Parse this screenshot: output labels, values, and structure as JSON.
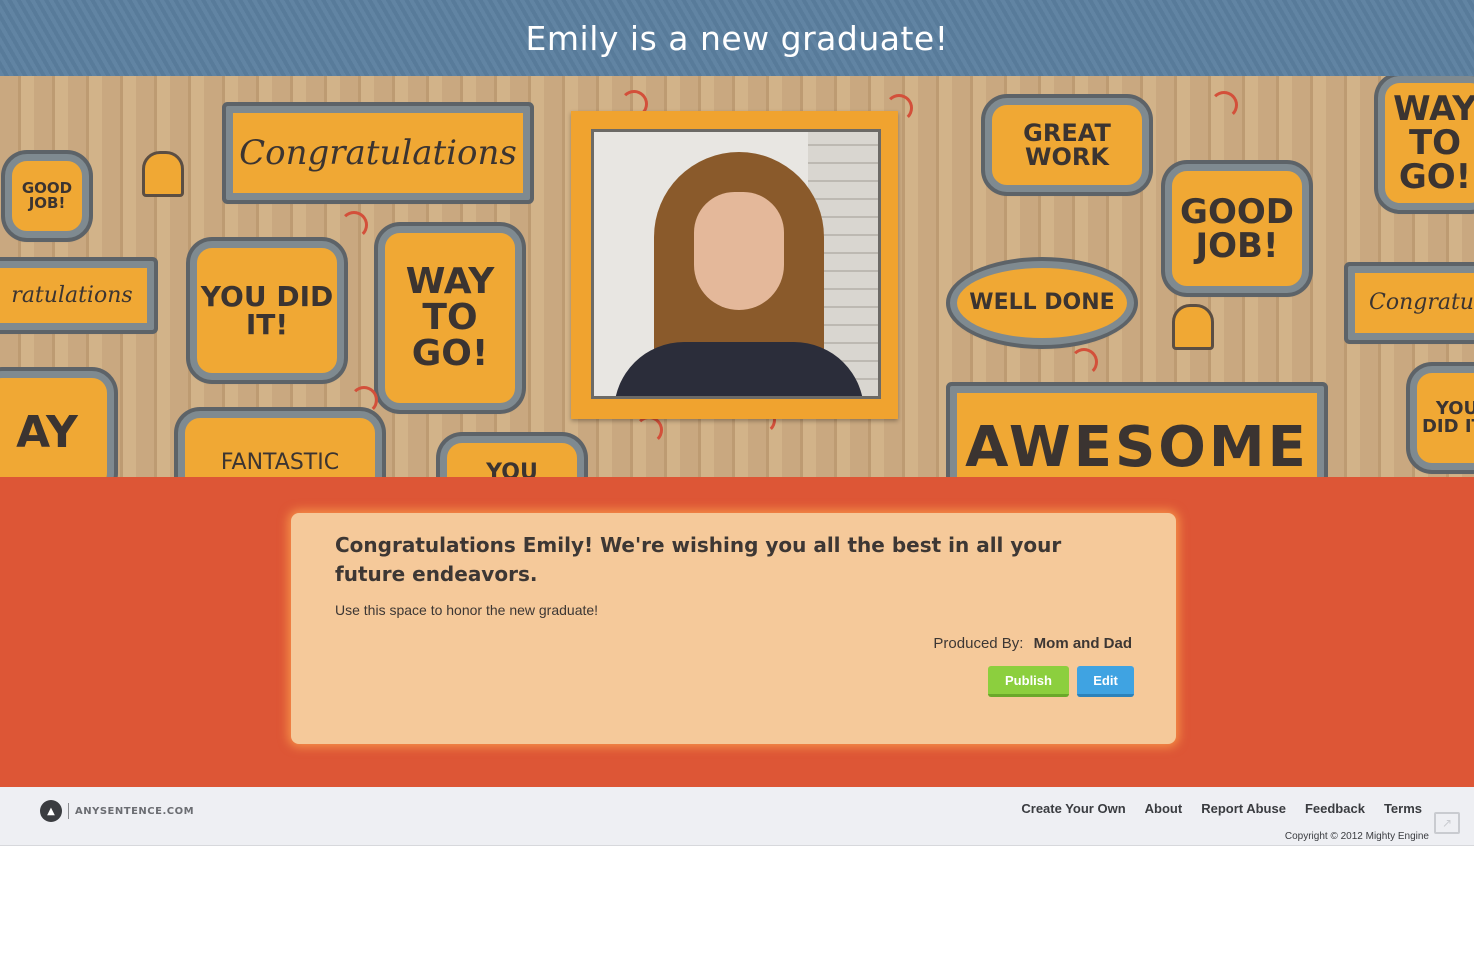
{
  "header": {
    "title": "Emily is a new graduate!"
  },
  "banner": {
    "frames": [
      {
        "text": "Congratulations"
      },
      {
        "text": "GOOD JOB!"
      },
      {
        "text": "YOU DID IT!"
      },
      {
        "text": "WAY TO GO!"
      },
      {
        "text": "ratulations"
      },
      {
        "text": "AY"
      },
      {
        "text": "FANTASTIC"
      },
      {
        "text": "YOU"
      },
      {
        "text": "GREAT WORK"
      },
      {
        "text": "GOOD JOB!"
      },
      {
        "text": "WAY TO GO!"
      },
      {
        "text": "WELL DONE"
      },
      {
        "text": "Congratul"
      },
      {
        "text": "YOU DID IT!"
      },
      {
        "text": "AWESOME"
      }
    ],
    "photo": {
      "subject": "graduate-portrait"
    }
  },
  "card": {
    "message": "Congratulations Emily! We're wishing you all the best in all your future endeavors.",
    "subtext": "Use this space to honor the new graduate!",
    "produced_by_label": "Produced By:",
    "produced_by_name": "Mom and Dad",
    "publish_label": "Publish",
    "edit_label": "Edit"
  },
  "footer": {
    "logo_text": "ANYSENTENCE.COM",
    "links": [
      "Create Your Own",
      "About",
      "Report Abuse",
      "Feedback",
      "Terms"
    ],
    "copyright": "Copyright © 2012 Mighty Engine"
  },
  "colors": {
    "header_bg": "#5b7f9f",
    "main_bg": "#dd5636",
    "card_bg": "#f5c99a",
    "publish_btn": "#8ccf3e",
    "edit_btn": "#3fa3e2"
  }
}
